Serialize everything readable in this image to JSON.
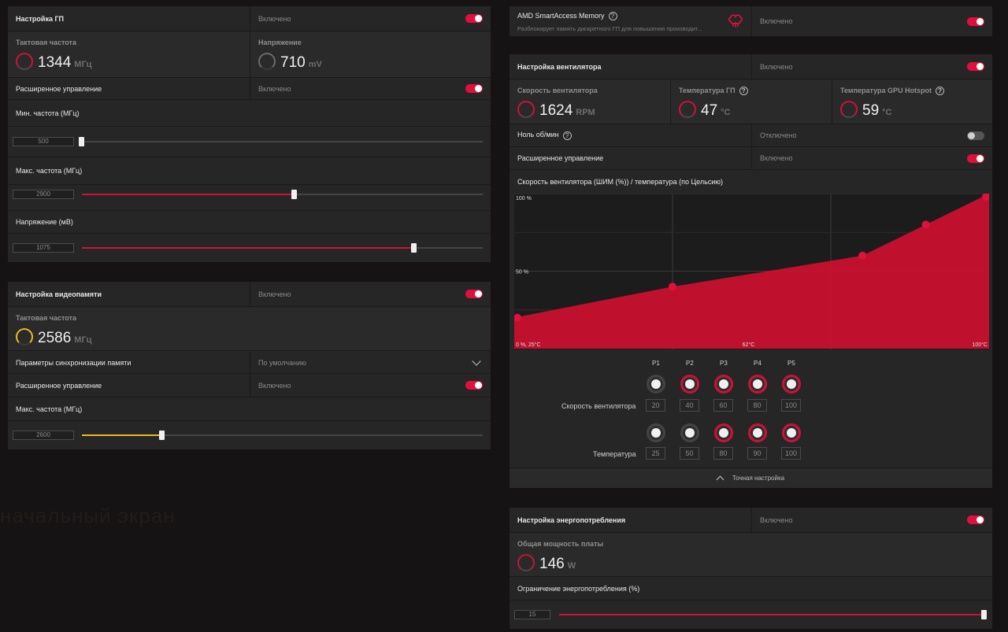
{
  "background": {
    "text": "начальный экран"
  },
  "gpu": {
    "title": "Настройка ГП",
    "status": "Включено",
    "clock": {
      "label": "Тактовая частота",
      "value": "1344",
      "unit": "МГц"
    },
    "voltage": {
      "label": "Напряжение",
      "value": "710",
      "unit": "mV"
    },
    "advanced": {
      "label": "Расширенное управление",
      "status": "Включено"
    },
    "min_freq": {
      "label": "Мин. частота (МГц)",
      "value": "500",
      "fraction": 0.0
    },
    "max_freq": {
      "label": "Макс. частота (МГц)",
      "value": "2900",
      "fraction": 0.53
    },
    "voltage_mv": {
      "label": "Напряжение (мВ)",
      "value": "1075",
      "fraction": 0.83
    }
  },
  "vram": {
    "title": "Настройка видеопамяти",
    "status": "Включено",
    "clock": {
      "label": "Тактовая частота",
      "value": "2586",
      "unit": "МГц"
    },
    "timing": {
      "label": "Параметры синхронизации памяти",
      "value": "По умолчанию"
    },
    "advanced": {
      "label": "Расширенное управление",
      "status": "Включено"
    },
    "max_freq": {
      "label": "Макс. частота (МГц)",
      "value": "2600",
      "fraction": 0.2
    }
  },
  "sam": {
    "title": "AMD SmartAccess Memory",
    "help": "?",
    "subtitle": "Разблокирует память дискретного ГП для повышения производит...",
    "status": "Включено"
  },
  "fan": {
    "title": "Настройка вентилятора",
    "status": "Включено",
    "speed": {
      "label": "Скорость вентилятора",
      "value": "1624",
      "unit": "RPM"
    },
    "temp": {
      "label": "Температура ГП",
      "value": "47",
      "unit": "°C"
    },
    "hotspot": {
      "label": "Температура GPU Hotspot",
      "value": "59",
      "unit": "°C"
    },
    "zero_rpm": {
      "label": "Ноль об/мин",
      "status": "Отключено"
    },
    "advanced": {
      "label": "Расширенное управление",
      "status": "Включено"
    },
    "curve_title": "Скорость вентилятора (ШИМ (%)) / температура (по Цельсию)",
    "fine_tune": "Точная настройка",
    "row_speed_label": "Скорость вентилятора",
    "row_temp_label": "Температура",
    "points": [
      {
        "name": "P1",
        "speed": "20",
        "temp": "25"
      },
      {
        "name": "P2",
        "speed": "40",
        "temp": "50"
      },
      {
        "name": "P3",
        "speed": "60",
        "temp": "80"
      },
      {
        "name": "P4",
        "speed": "80",
        "temp": "90"
      },
      {
        "name": "P5",
        "speed": "100",
        "temp": "100"
      }
    ]
  },
  "chart_data": {
    "type": "area",
    "title": "Скорость вентилятора (ШИМ (%)) / температура (по Цельсию)",
    "x": [
      25,
      50,
      80,
      90,
      100
    ],
    "y": [
      20,
      40,
      60,
      80,
      100
    ],
    "xlim": [
      25,
      100
    ],
    "ylim": [
      0,
      100
    ],
    "tick_labels": {
      "y_top": "100 %",
      "y_mid": "50 %",
      "x_origin": "0 %, 25°C",
      "x_mid": "62°C",
      "x_end": "100°C"
    },
    "grid": true,
    "color": "#c8102e"
  },
  "power": {
    "title": "Настройка энергопотребления",
    "status": "Включено",
    "board_power": {
      "label": "Общая мощность платы",
      "value": "146",
      "unit": "W"
    },
    "limit": {
      "label": "Ограничение энергопотребления (%)",
      "value": "15",
      "fraction": 1.0
    }
  },
  "colors": {
    "accent": "#d0103a",
    "memory_accent": "#e8b823",
    "panel": "#262626",
    "background": "#151313"
  }
}
